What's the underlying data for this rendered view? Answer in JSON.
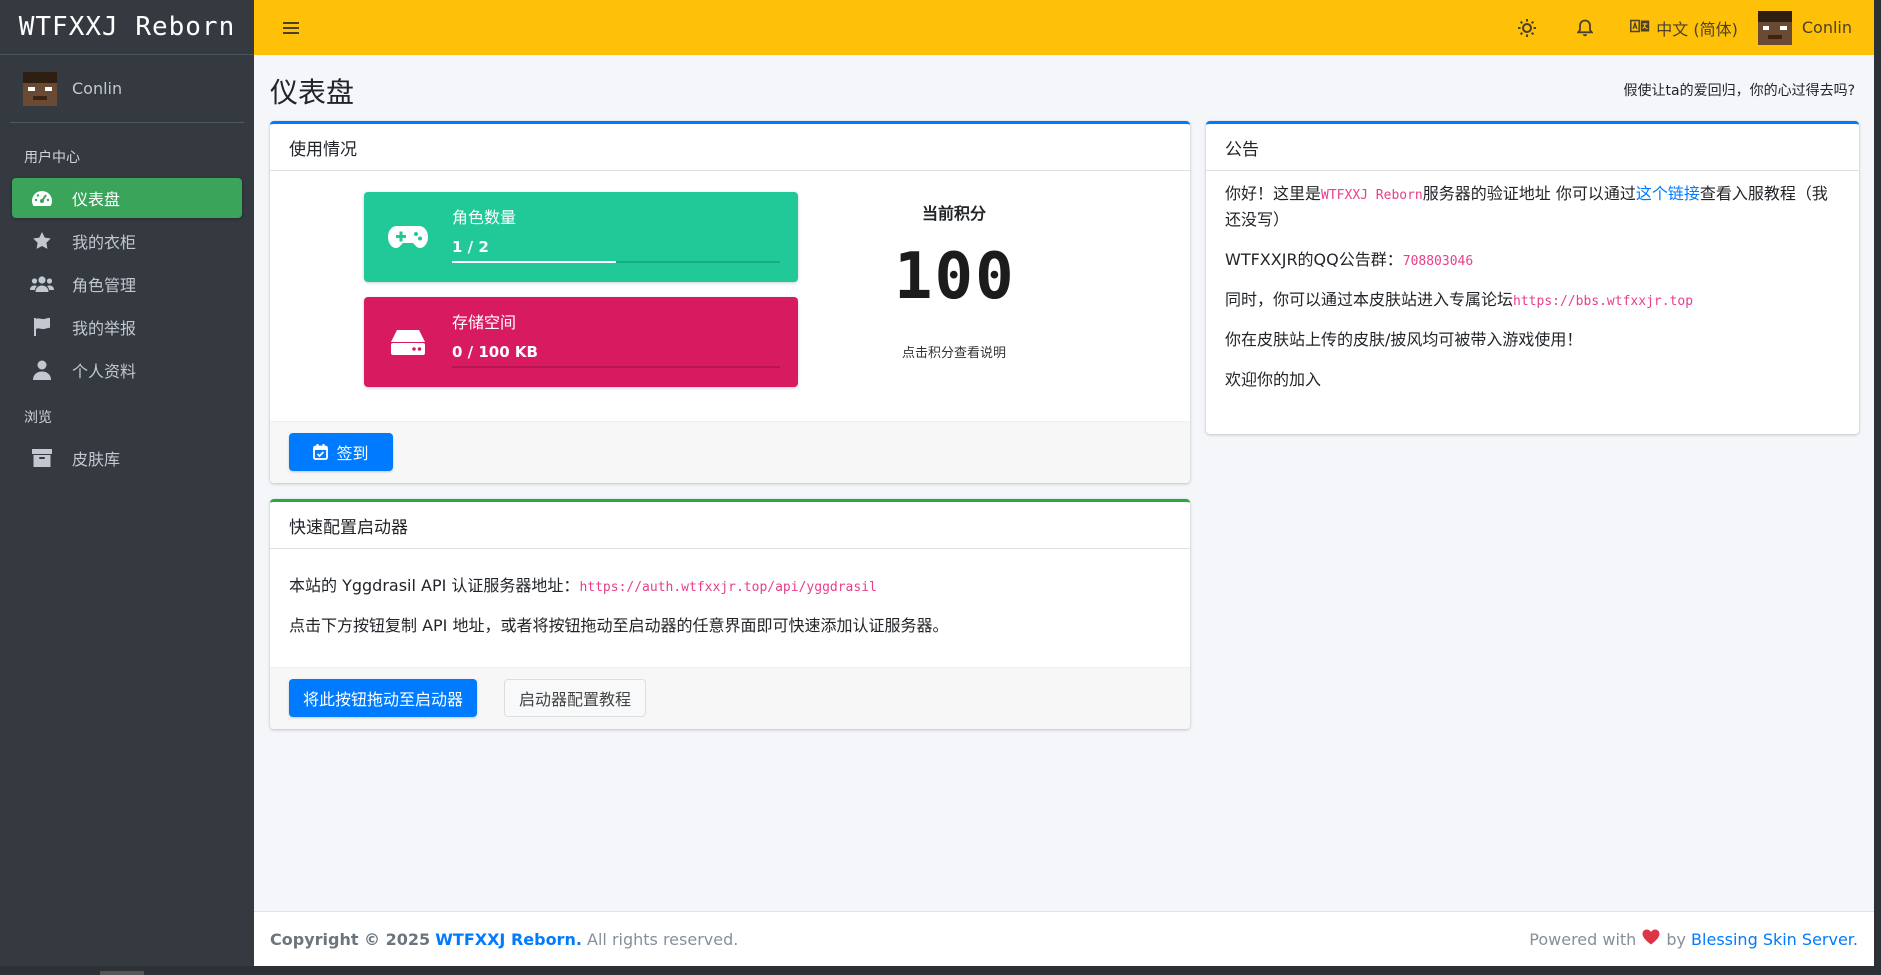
{
  "brand": "WTFXXJ Reborn",
  "user": {
    "name": "Conlin"
  },
  "sidebar": {
    "section_user": "用户中心",
    "section_browse": "浏览",
    "items": [
      {
        "label": "仪表盘",
        "icon": "dashboard-icon",
        "active": true
      },
      {
        "label": "我的衣柜",
        "icon": "star-icon"
      },
      {
        "label": "角色管理",
        "icon": "users-icon"
      },
      {
        "label": "我的举报",
        "icon": "flag-icon"
      },
      {
        "label": "个人资料",
        "icon": "user-icon"
      }
    ],
    "browse_items": [
      {
        "label": "皮肤库",
        "icon": "archive-icon"
      }
    ]
  },
  "topbar": {
    "menu_icon": "hamburger-icon",
    "theme_icon": "sun-icon",
    "notification_icon": "bell-icon",
    "language": "中文 (简体)",
    "language_icon": "language-icon"
  },
  "page": {
    "title": "仪表盘",
    "motto": "假使让ta的爱回归，你的心过得去吗?"
  },
  "usage": {
    "title": "使用情况",
    "players": {
      "label": "角色数量",
      "value": "1 / 2",
      "progress": 0.5,
      "color": "#20c997",
      "icon": "gamepad-icon"
    },
    "storage": {
      "label": "存储空间",
      "value": "0 / 100 KB",
      "progress": 0.0,
      "color": "#d81b60",
      "icon": "hdd-icon"
    },
    "score_title": "当前积分",
    "score": "100",
    "score_hint": "点击积分查看说明",
    "sign_button": "签到",
    "sign_icon": "calendar-check-icon"
  },
  "launcher": {
    "title": "快速配置启动器",
    "line1_prefix": "本站的 Yggdrasil API 认证服务器地址：",
    "api_url": "https://auth.wtfxxjr.top/api/yggdrasil",
    "line2": "点击下方按钮复制 API 地址，或者将按钮拖动至启动器的任意界面即可快速添加认证服务器。",
    "drag_button": "将此按钮拖动至启动器",
    "tutorial_button": "启动器配置教程"
  },
  "announcement": {
    "title": "公告",
    "p1_a": "你好！这里是",
    "p1_code": "WTFXXJ Reborn",
    "p1_b": "服务器的验证地址 你可以通过",
    "p1_link": "这个链接",
    "p1_c": "查看入服教程（我",
    "p1_d": "还没写）",
    "p2_a": "WTFXXJR的QQ公告群：",
    "p2_code": "708803046",
    "p3_a": "同时，你可以通过本皮肤站进入专属论坛",
    "p3_code": "https://bbs.wtfxxjr.top",
    "p4": "你在皮肤站上传的皮肤/披风均可被带入游戏使用！",
    "p5": "欢迎你的加入"
  },
  "footer": {
    "copyright_prefix": "Copyright © 2025",
    "site": "WTFXXJ Reborn.",
    "rights": "All rights reserved.",
    "powered_prefix": "Powered with",
    "by": "by",
    "powered_link": "Blessing Skin Server."
  },
  "colors": {
    "topbar": "#ffc107",
    "sidebar": "#343a40",
    "active_nav": "#3aa55a",
    "primary": "#007bff",
    "success": "#28a745"
  }
}
